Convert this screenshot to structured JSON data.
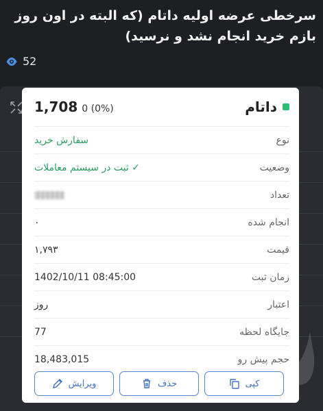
{
  "post": {
    "title": "سرخطی عرضه اولیه داتام (که البته در اون روز بازم خرید انجام نشد و نرسید)",
    "views": "52"
  },
  "order": {
    "symbol": "داتام",
    "price": "1,708",
    "change": "0 (0%)",
    "rows": [
      {
        "label": "نوع",
        "value": "سفارش خرید",
        "style": "green"
      },
      {
        "label": "وضعیت",
        "value": "✓ ثبت در سیستم معاملات",
        "style": "green"
      },
      {
        "label": "تعداد",
        "value": "",
        "style": "blurred"
      },
      {
        "label": "انجام شده",
        "value": "۰",
        "style": ""
      },
      {
        "label": "قیمت",
        "value": "۱,۷۹۳",
        "style": ""
      },
      {
        "label": "زمان ثبت",
        "value": "1402/10/11 08:45:00",
        "style": "ltr"
      },
      {
        "label": "اعتبار",
        "value": "روز",
        "style": ""
      },
      {
        "label": "جایگاه لحظه",
        "value": "77",
        "style": "ltr"
      },
      {
        "label": "حجم پیش رو",
        "value": "18,483,015",
        "style": "ltr"
      }
    ],
    "buttons": {
      "edit": "ویرایش",
      "delete": "حذف",
      "copy": "کپی"
    }
  },
  "colors": {
    "accent_green": "#2ebd74",
    "button_blue": "#3e70c9"
  }
}
